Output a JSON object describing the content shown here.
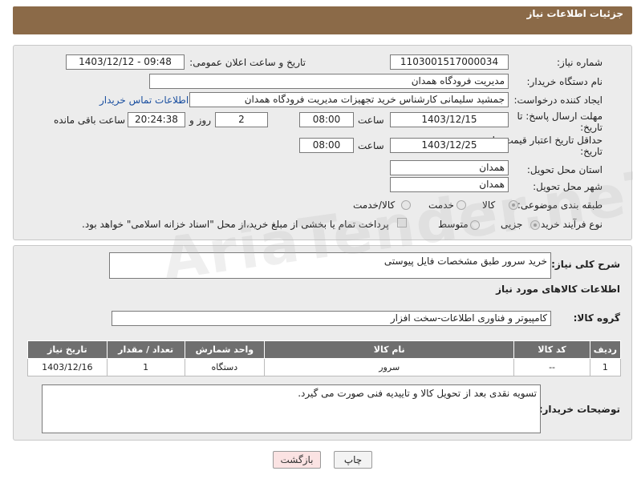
{
  "header": {
    "title": "جزئیات اطلاعات نیاز"
  },
  "fields": {
    "need_number_label": "شماره نیاز:",
    "need_number": "1103001517000034",
    "announce_label": "تاریخ و ساعت اعلان عمومی:",
    "announce_value": "1403/12/12 - 09:48",
    "buyer_label": "نام دستگاه خریدار:",
    "buyer": "مدیریت فرودگاه همدان",
    "creator_label": "ایجاد کننده درخواست:",
    "creator": "جمشید سلیمانی کارشناس خرید تجهیزات مدیریت فرودگاه همدان",
    "contact_link": "اطلاعات تماس خریدار",
    "deadline_label_1": "مهلت ارسال پاسخ: تا",
    "deadline_label_2": "تاریخ:",
    "deadline_date": "1403/12/15",
    "time_label": "ساعت",
    "deadline_time": "08:00",
    "days_value": "2",
    "days_label": "روز و",
    "remaining_time": "20:24:38",
    "remaining_label": "ساعت باقی مانده",
    "price_label_1": "حداقل تاریخ اعتبار قیمت: تا",
    "price_label_2": "تاریخ:",
    "price_date": "1403/12/25",
    "price_time": "08:00",
    "province_label": "استان محل تحویل:",
    "province": "همدان",
    "city_label": "شهر محل تحویل:",
    "city": "همدان",
    "category_label": "طبقه بندی موضوعی:",
    "category_options": [
      "کالا",
      "خدمت",
      "کالا/خدمت"
    ],
    "process_label": "نوع فرآیند خرید :",
    "process_options": [
      "جزیی",
      "متوسط"
    ],
    "payment_note": "پرداخت تمام یا بخشی از مبلغ خرید،از محل \"اسناد خزانه اسلامی\" خواهد بود."
  },
  "description": {
    "label": "شرح کلی نیاز:",
    "value": "خرید سرور طبق مشخصات فایل پیوستی"
  },
  "goods_section": {
    "title": "اطلاعات کالاهای مورد نیاز",
    "group_label": "گروه کالا:",
    "group_value": "کامپیوتر و فناوری اطلاعات-سخت افزار"
  },
  "table": {
    "headers": [
      "ردیف",
      "کد کالا",
      "نام کالا",
      "واحد شمارش",
      "تعداد / مقدار",
      "تاریخ نیاز"
    ],
    "rows": [
      [
        "1",
        "--",
        "سرور",
        "دستگاه",
        "1",
        "1403/12/16"
      ]
    ]
  },
  "buyer_notes": {
    "label": "توضیحات خریدار:",
    "value": "تسویه نقدی بعد از تحویل کالا و تاییدیه فنی صورت می گیرد."
  },
  "buttons": {
    "print": "چاپ",
    "back": "بازگشت"
  },
  "watermark": "AriaTender.neT",
  "colors": {
    "header": "#8b6a48",
    "table_header": "#6f6f6f",
    "link": "#1a4fa0"
  }
}
